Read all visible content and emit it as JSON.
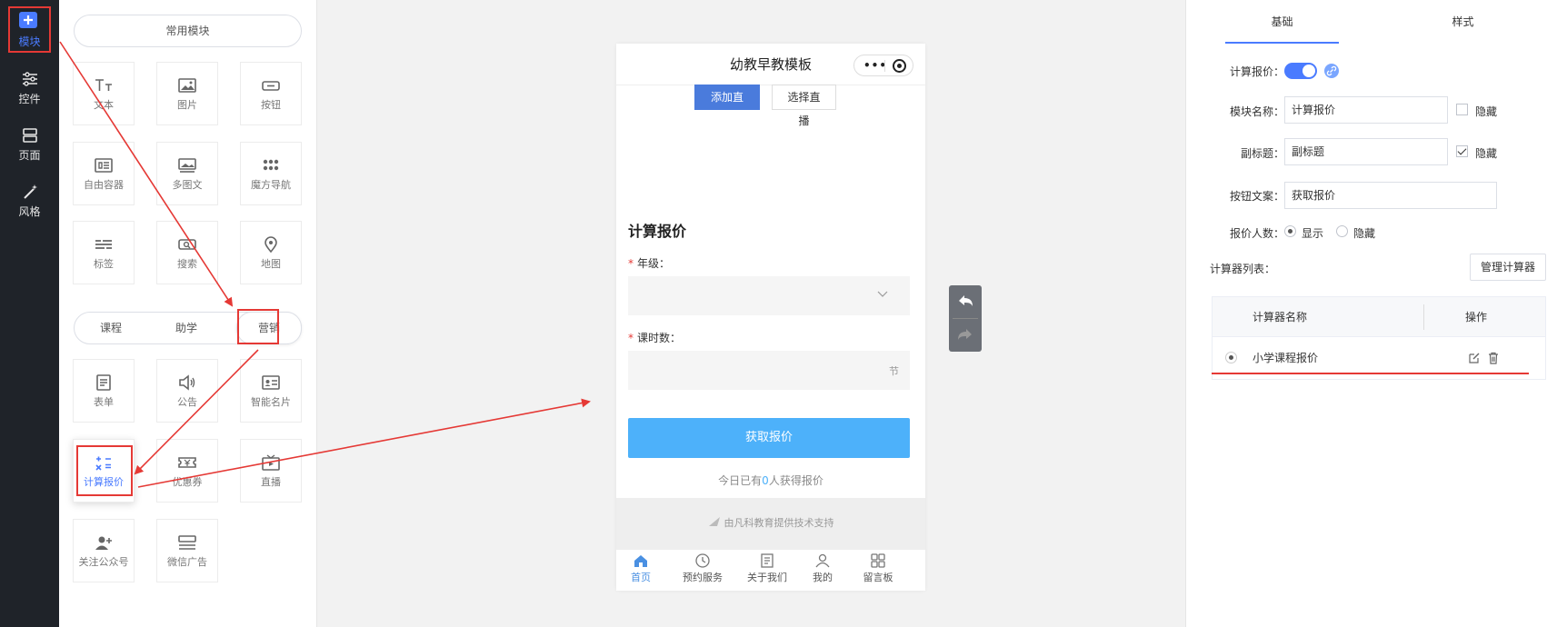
{
  "leftnav": {
    "items": [
      {
        "label": "模块",
        "icon": "plus-square-icon"
      },
      {
        "label": "控件",
        "icon": "sliders-icon"
      },
      {
        "label": "页面",
        "icon": "page-layout-icon"
      },
      {
        "label": "风格",
        "icon": "magic-wand-icon"
      }
    ]
  },
  "modules": {
    "common_tab": "常用模块",
    "common_tiles": [
      {
        "label": "文本",
        "icon": "text-icon"
      },
      {
        "label": "图片",
        "icon": "image-icon"
      },
      {
        "label": "按钮",
        "icon": "button-icon"
      },
      {
        "label": "自由容器",
        "icon": "container-icon"
      },
      {
        "label": "多图文",
        "icon": "multi-image-icon"
      },
      {
        "label": "魔方导航",
        "icon": "grid-dots-icon"
      },
      {
        "label": "标签",
        "icon": "tag-lines-icon"
      },
      {
        "label": "搜索",
        "icon": "search-box-icon"
      },
      {
        "label": "地图",
        "icon": "map-pin-icon"
      }
    ],
    "category_tabs": [
      "课程",
      "助学",
      "营销"
    ],
    "active_category": "营销",
    "marketing_tiles": [
      {
        "label": "表单",
        "icon": "form-icon"
      },
      {
        "label": "公告",
        "icon": "speaker-icon"
      },
      {
        "label": "智能名片",
        "icon": "card-icon"
      },
      {
        "label": "计算报价",
        "icon": "calculator-icon"
      },
      {
        "label": "优惠券",
        "icon": "coupon-icon"
      },
      {
        "label": "直播",
        "icon": "live-tv-icon"
      },
      {
        "label": "关注公众号",
        "icon": "follow-user-icon"
      },
      {
        "label": "微信广告",
        "icon": "ad-banner-icon"
      }
    ]
  },
  "phone": {
    "title": "幼教早教模板",
    "btn_add_live": "添加直播",
    "btn_select_live": "选择直播",
    "section_title": "计算报价",
    "field1_label": "年级：",
    "field2_label": "课时数：",
    "field2_unit": "节",
    "required_mark": "*",
    "submit_label": "获取报价",
    "note_prefix": "今日已有",
    "note_count": "0",
    "note_suffix": "人获得报价",
    "footer_text": "由凡科教育提供技术支持",
    "tabs": [
      {
        "label": "首页",
        "icon": "home-icon",
        "active": true
      },
      {
        "label": "预约服务",
        "icon": "clock-icon"
      },
      {
        "label": "关于我们",
        "icon": "document-icon"
      },
      {
        "label": "我的",
        "icon": "user-icon"
      },
      {
        "label": "留言板",
        "icon": "grid-icon"
      }
    ]
  },
  "settings": {
    "tabs": [
      "基础",
      "样式"
    ],
    "calc_quote_label": "计算报价：",
    "module_name_label": "模块名称：",
    "module_name_value": "计算报价",
    "hide_label": "隐藏",
    "subtitle_label": "副标题：",
    "subtitle_value": "副标题",
    "button_text_label": "按钮文案：",
    "button_text_value": "获取报价",
    "quote_count_label": "报价人数：",
    "show_option": "显示",
    "hide_option": "隐藏",
    "calc_list_label": "计算器列表：",
    "manage_btn": "管理计算器",
    "table_headers": [
      "计算器名称",
      "操作"
    ],
    "table_rows": [
      {
        "name": "小学课程报价"
      }
    ]
  },
  "colors": {
    "accent": "#4a7bff",
    "submit": "#4db1fa",
    "annotation_red": "#e53935",
    "nav_bg": "#1f2329"
  }
}
